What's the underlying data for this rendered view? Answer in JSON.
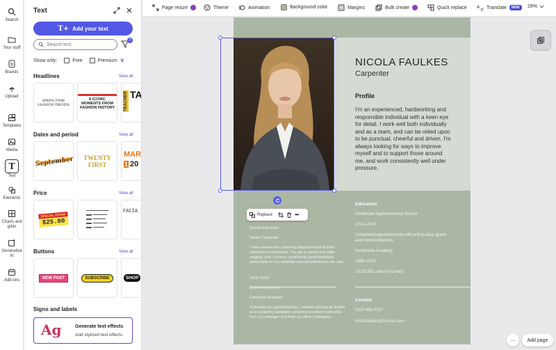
{
  "rail": {
    "items": [
      {
        "label": "Search",
        "icon": "search-icon"
      },
      {
        "label": "Your stuff",
        "icon": "folder-icon"
      },
      {
        "label": "Brands",
        "icon": "brand-icon"
      },
      {
        "label": "Upload",
        "icon": "upload-icon"
      },
      {
        "label": "Templates",
        "icon": "templates-icon"
      },
      {
        "label": "Media",
        "icon": "media-icon"
      },
      {
        "label": "Text",
        "icon": "text-icon",
        "active": true
      },
      {
        "label": "Elements",
        "icon": "elements-icon"
      },
      {
        "label": "Charts and grids",
        "icon": "charts-icon"
      },
      {
        "label": "Generative AI",
        "icon": "generative-ai-icon"
      },
      {
        "label": "Add-ons",
        "icon": "addons-icon"
      }
    ]
  },
  "panel": {
    "title": "Text",
    "add_button": "Add your text",
    "search_placeholder": "Search text",
    "filter_count": "2",
    "show_only": "Show only:",
    "free": "Free",
    "premium": "Premium",
    "view_all": "View all",
    "sections": {
      "headlines": "Headlines",
      "dates": "Dates and period",
      "price": "Price",
      "buttons": "Buttons",
      "signs": "Signs and labels"
    },
    "thumbs": {
      "headline_1": "SPRINGTIME FASHION TRENDS",
      "headline_2": "8 ICONIC MOMENTS FROM FASHION HISTORY",
      "headline_3a": "TEACHER",
      "headline_3b": "TA",
      "date_1": "September",
      "date_2a": "TWENTY",
      "date_2b": "FIRST",
      "date_3a": "MAR",
      "date_3b": "1",
      "date_3c": "20",
      "price_1a": "SPECIAL OFFER",
      "price_1b": "$25.00",
      "price_3": "FACIA",
      "button_1": "NEW POST",
      "button_2": "SUBSCRIBE",
      "button_3": "SHOP"
    },
    "gen_card": {
      "glyph": "Ag",
      "title": "Generate text effects",
      "subtitle": "Add stylized text effects"
    }
  },
  "toolbar": {
    "items": [
      {
        "label": "Page resize",
        "icon": "resize-icon",
        "premium": true
      },
      {
        "label": "Theme",
        "icon": "theme-icon"
      },
      {
        "label": "Animation",
        "icon": "animation-icon"
      },
      {
        "label": "Background color",
        "icon": "background-color-icon"
      },
      {
        "label": "Margins",
        "icon": "margins-icon"
      },
      {
        "label": "Bulk create",
        "icon": "bulk-create-icon",
        "premium": true
      },
      {
        "label": "Quick replace",
        "icon": "quick-replace-icon"
      },
      {
        "label": "Translate",
        "icon": "translate-icon",
        "badge": "NEW"
      }
    ],
    "zoom": "26%"
  },
  "resume": {
    "name": "NICOLA FAULKES",
    "role": "Carpenter",
    "profile_heading": "Profile",
    "profile_text": "I'm an experienced, hardworking and responsible individual with a keen eye for detail. I work well both individually and as a team, and can be relied upon to be punctual, cheerful and driven. I'm always looking for ways to improve myself and to support those around me, and work consistently well under pressure.",
    "work": [
      "Subrikt Industries",
      "Senior Carpenter",
      "I now oversee the carpentry department at Subrikt Industries in Barkerton. The job is varied and wide-ranging, and I receive consistently good feedback, particularly on my reliability and commitment to the role.",
      "2016–2018",
      "Subrikt Industries",
      "Carpentry Assistant",
      "Following my apprenticeship, I started working at Subrikt as a carpentry assistant, receiving excellent instruction from my manager and from my other colleagues."
    ],
    "education_heading": "Education",
    "education": [
      "Ambleside Apprenticeship School",
      "2012–2016",
      "Completed apprenticeship with a first-class grade and commendations.",
      "Ambleside Academy",
      "1999–2012",
      "10 GCSEs and 3 A-Levels"
    ],
    "contact_heading": "Contact",
    "phone": "0113 496 0010",
    "email": "nicolafaulkes@cv.site.com"
  },
  "context_menu": {
    "replace": "Replace"
  },
  "canvas": {
    "more": "···",
    "add_page": "Add page"
  },
  "colors": {
    "accent": "#5258e4",
    "page_bg": "#abb7a5",
    "header_bg": "#d5dbd2",
    "premium": "#8b3fbd"
  }
}
